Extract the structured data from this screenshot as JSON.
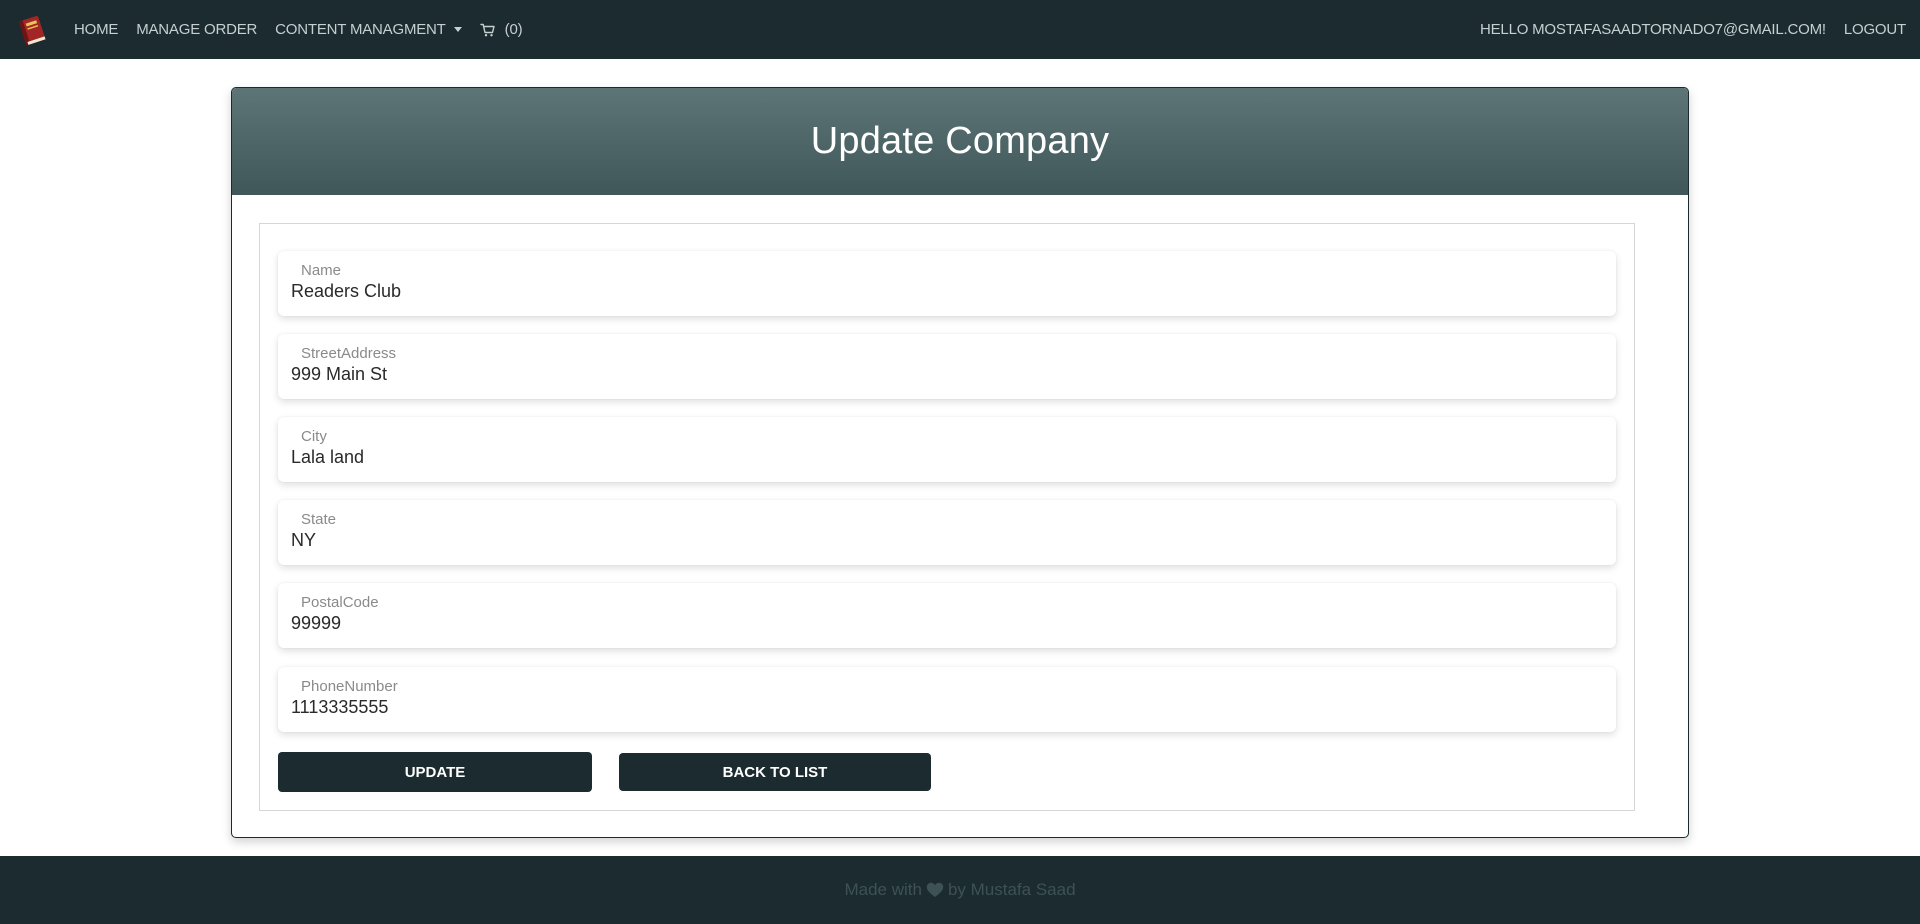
{
  "navbar": {
    "brand_icon": "book-icon",
    "home": "HOME",
    "manage_order": "MANAGE ORDER",
    "content_management": "CONTENT MANAGMENT",
    "cart_count": "(0)",
    "greeting": "HELLO MOSTAFASAADTORNADO7@GMAIL.COM!",
    "logout": "LOGOUT"
  },
  "card": {
    "title": "Update Company"
  },
  "form": {
    "fields": [
      {
        "label": "Name",
        "value": "Readers Club"
      },
      {
        "label": "StreetAddress",
        "value": "999 Main St"
      },
      {
        "label": "City",
        "value": "Lala land"
      },
      {
        "label": "State",
        "value": "NY"
      },
      {
        "label": "PostalCode",
        "value": "99999"
      },
      {
        "label": "PhoneNumber",
        "value": "1113335555"
      }
    ],
    "update_label": "UPDATE",
    "back_label": "BACK TO LIST"
  },
  "footer": {
    "text_before": "Made with",
    "text_after": "by Mustafa Saad",
    "heart_icon": "heart-icon"
  },
  "colors": {
    "navbar_bg": "#1b2b2f",
    "header_gradient_top": "#5d7576",
    "header_gradient_bottom": "#3f5759",
    "button_bg": "#1b2b2f"
  }
}
